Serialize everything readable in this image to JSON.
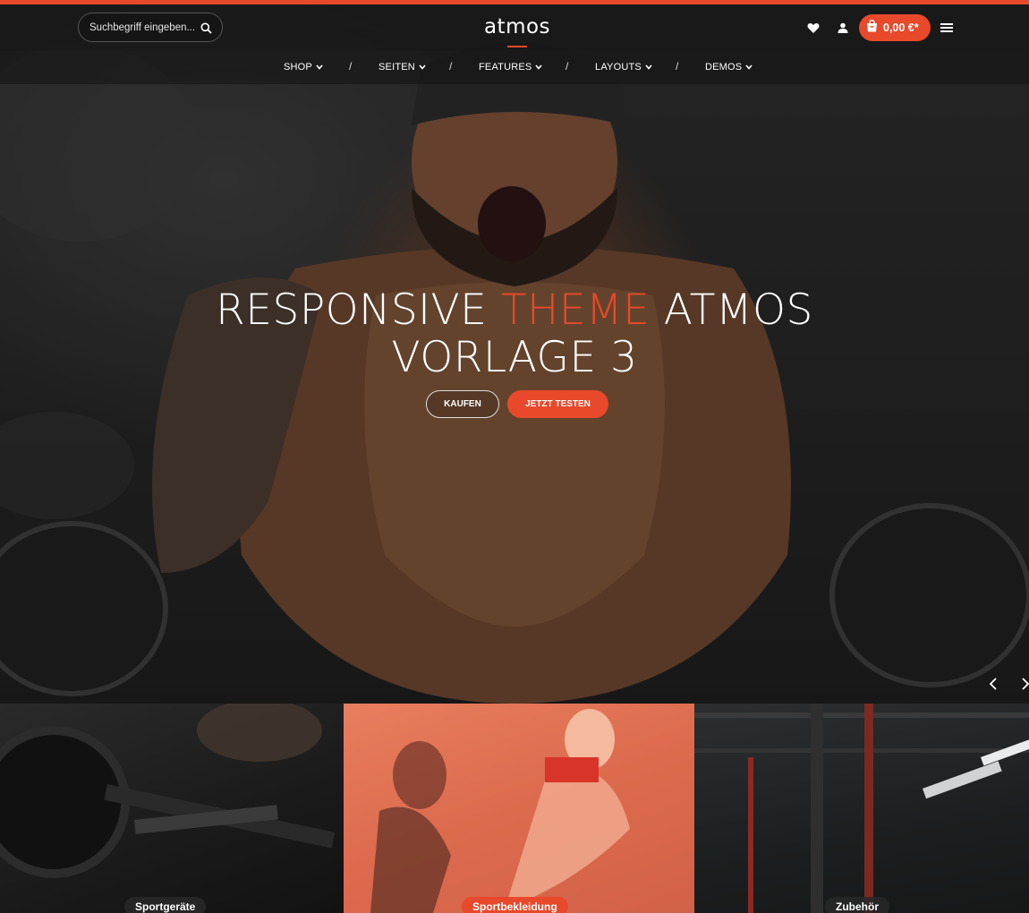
{
  "brand": {
    "name": "atmos",
    "accent_color": "#e8492a"
  },
  "header": {
    "search": {
      "placeholder": "Suchbegriff eingeben...",
      "icon": "search-icon"
    },
    "icons": {
      "wishlist": "heart-icon",
      "account": "user-icon",
      "cart": "shopping-bag-icon",
      "menu": "hamburger-menu-icon"
    },
    "cart_total": "0,00 €*"
  },
  "nav": {
    "items": [
      {
        "label": "SHOP"
      },
      {
        "label": "SEITEN"
      },
      {
        "label": "FEATURES"
      },
      {
        "label": "LAYOUTS"
      },
      {
        "label": "DEMOS"
      }
    ],
    "separator": "/"
  },
  "hero": {
    "headline_part1": "RESPONSIVE ",
    "headline_accent": "THEME",
    "headline_part2": " ATMOS",
    "headline_line2": "VORLAGE 3",
    "buttons": {
      "outline": "KAUFEN",
      "primary": "JETZT TESTEN"
    },
    "arrows": {
      "prev": "chevron-left-icon",
      "next": "chevron-right-icon"
    }
  },
  "categories": [
    {
      "label": "Sportgeräte"
    },
    {
      "label": "Sportbekleidung"
    },
    {
      "label": "Zubehör"
    }
  ]
}
